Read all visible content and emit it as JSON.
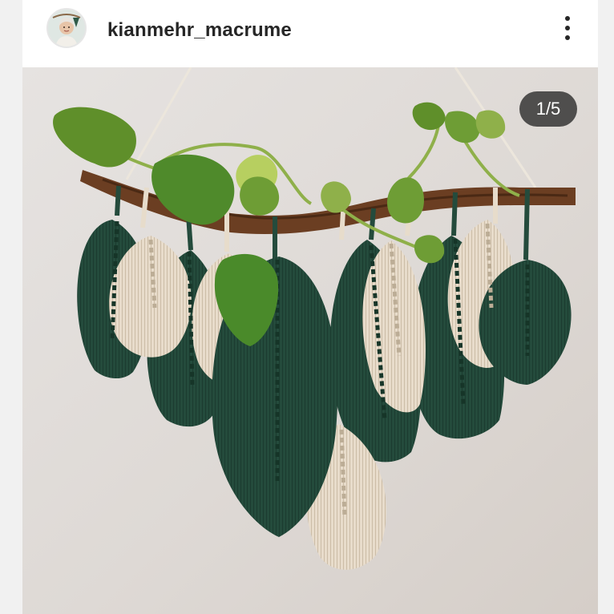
{
  "post": {
    "username": "kianmehr_macrume",
    "more_icon": "more-vertical-icon",
    "avatar_icon": "profile-avatar",
    "media_counter": "1/5"
  },
  "colors": {
    "background": "#f1f1f1",
    "card": "#ffffff",
    "text": "#262626",
    "counter_bg": "#262626",
    "green_leaf": "#244b3c",
    "cream_leaf": "#e8dccb",
    "branch": "#6b3e22"
  }
}
